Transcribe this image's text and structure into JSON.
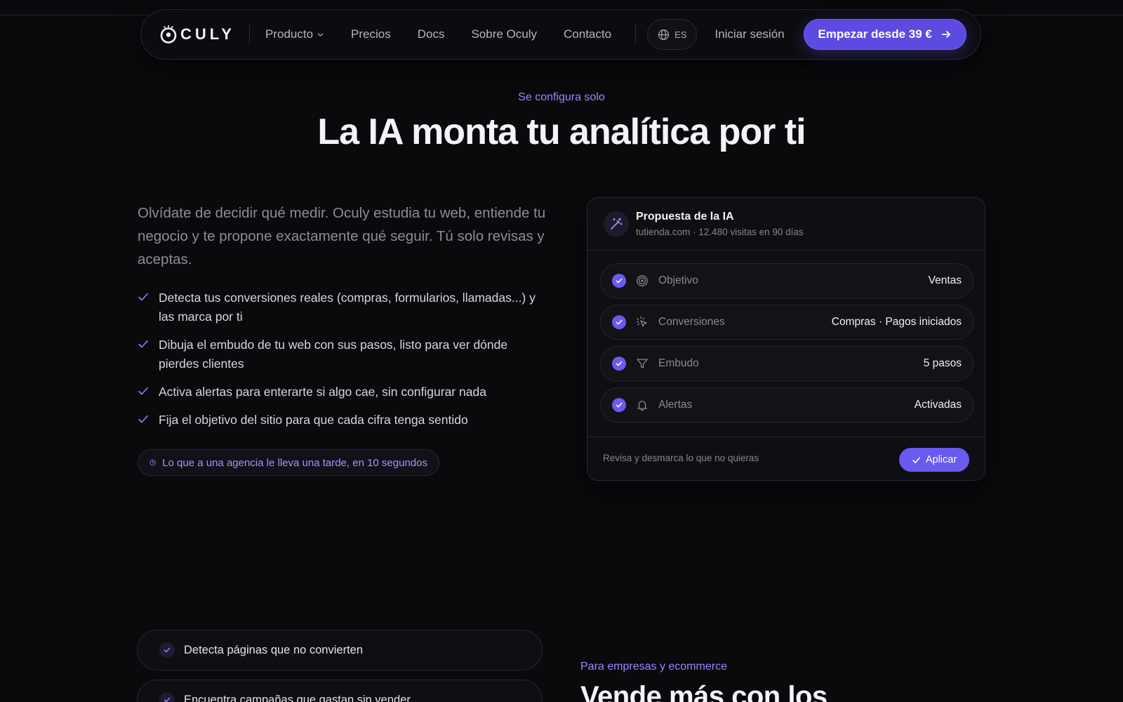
{
  "nav": {
    "brand": "CULY",
    "links": [
      {
        "label": "Producto",
        "has_dropdown": true
      },
      {
        "label": "Precios"
      },
      {
        "label": "Docs"
      },
      {
        "label": "Sobre Oculy"
      },
      {
        "label": "Contacto"
      }
    ],
    "language": "ES",
    "login": "Iniciar sesión",
    "cta": "Empezar desde 39 €"
  },
  "hero": {
    "eyebrow": "Se configura solo",
    "title": "La IA monta tu analítica por ti",
    "lead": "Olvídate de decidir qué medir. Oculy estudia tu web, entiende tu negocio y te propone exactamente qué seguir. Tú solo revisas y aceptas.",
    "features": [
      "Detecta tus conversiones reales (compras, formularios, llamadas...) y las marca por ti",
      "Dibuja el embudo de tu web con sus pasos, listo para ver dónde pierdes clientes",
      "Activa alertas para enterarte si algo cae, sin configurar nada",
      "Fija el objetivo del sitio para que cada cifra tenga sentido"
    ],
    "time_note": "Lo que a una agencia le lleva una tarde, en 10 segundos"
  },
  "proposal": {
    "title": "Propuesta de la IA",
    "subtitle": "tutienda.com · 12.480 visitas en 90 días",
    "rows": [
      {
        "icon": "target-icon",
        "label": "Objetivo",
        "value": "Ventas",
        "checked": true
      },
      {
        "icon": "click-icon",
        "label": "Conversiones",
        "value": "Compras · Pagos iniciados",
        "checked": true
      },
      {
        "icon": "funnel-icon",
        "label": "Embudo",
        "value": "5 pasos",
        "checked": true
      },
      {
        "icon": "bell-icon",
        "label": "Alertas",
        "value": "Activadas",
        "checked": true
      }
    ],
    "footer_note": "Revisa y desmarca lo que no quieras",
    "apply_label": "Aplicar"
  },
  "issues": [
    "Detecta páginas que no convierten",
    "Encuentra campañas que gastan sin vender"
  ],
  "section2": {
    "eyebrow": "Para empresas y ecommerce",
    "title": "Vende más con los"
  },
  "colors": {
    "accent": "#6a5af0",
    "cta": "#5b4be0",
    "eyebrow": "#9a86ff",
    "background": "#0a0a0d"
  }
}
